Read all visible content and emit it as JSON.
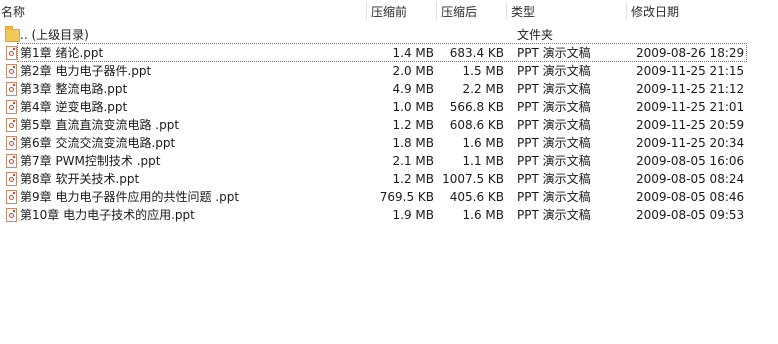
{
  "columns": {
    "name": "名称",
    "compressed_before": "压缩前",
    "compressed_after": "压缩后",
    "type": "类型",
    "modified": "修改日期"
  },
  "parent": {
    "name": ".. (上级目录)",
    "type": "文件夹",
    "icon": "folder-icon"
  },
  "files": [
    {
      "name": "第1章 绪论.ppt",
      "orig": "1.4 MB",
      "comp": "683.4 KB",
      "type": "PPT 演示文稿",
      "date": "2009-08-26 18:29",
      "icon": "ppt-file-icon"
    },
    {
      "name": "第2章 电力电子器件.ppt",
      "orig": "2.0 MB",
      "comp": "1.5 MB",
      "type": "PPT 演示文稿",
      "date": "2009-11-25 21:15",
      "icon": "ppt-file-icon"
    },
    {
      "name": "第3章 整流电路.ppt",
      "orig": "4.9 MB",
      "comp": "2.2 MB",
      "type": "PPT 演示文稿",
      "date": "2009-11-25 21:12",
      "icon": "ppt-file-icon"
    },
    {
      "name": "第4章 逆变电路.ppt",
      "orig": "1.0 MB",
      "comp": "566.8 KB",
      "type": "PPT 演示文稿",
      "date": "2009-11-25 21:01",
      "icon": "ppt-file-icon"
    },
    {
      "name": "第5章 直流直流变流电路 .ppt",
      "orig": "1.2 MB",
      "comp": "608.6 KB",
      "type": "PPT 演示文稿",
      "date": "2009-11-25 20:59",
      "icon": "ppt-file-icon"
    },
    {
      "name": "第6章 交流交流变流电路.ppt",
      "orig": "1.8 MB",
      "comp": "1.6 MB",
      "type": "PPT 演示文稿",
      "date": "2009-11-25 20:34",
      "icon": "ppt-file-icon"
    },
    {
      "name": "第7章 PWM控制技术 .ppt",
      "orig": "2.1 MB",
      "comp": "1.1 MB",
      "type": "PPT 演示文稿",
      "date": "2009-08-05 16:06",
      "icon": "ppt-file-icon"
    },
    {
      "name": "第8章 软开关技术.ppt",
      "orig": "1.2 MB",
      "comp": "1007.5 KB",
      "type": "PPT 演示文稿",
      "date": "2009-08-05 08:24",
      "icon": "ppt-file-icon"
    },
    {
      "name": "第9章 电力电子器件应用的共性问题 .ppt",
      "orig": "769.5 KB",
      "comp": "405.6 KB",
      "type": "PPT 演示文稿",
      "date": "2009-08-05 08:46",
      "icon": "ppt-file-icon"
    },
    {
      "name": "第10章 电力电子技术的应用.ppt",
      "orig": "1.9 MB",
      "comp": "1.6 MB",
      "type": "PPT 演示文稿",
      "date": "2009-08-05 09:53",
      "icon": "ppt-file-icon"
    }
  ]
}
